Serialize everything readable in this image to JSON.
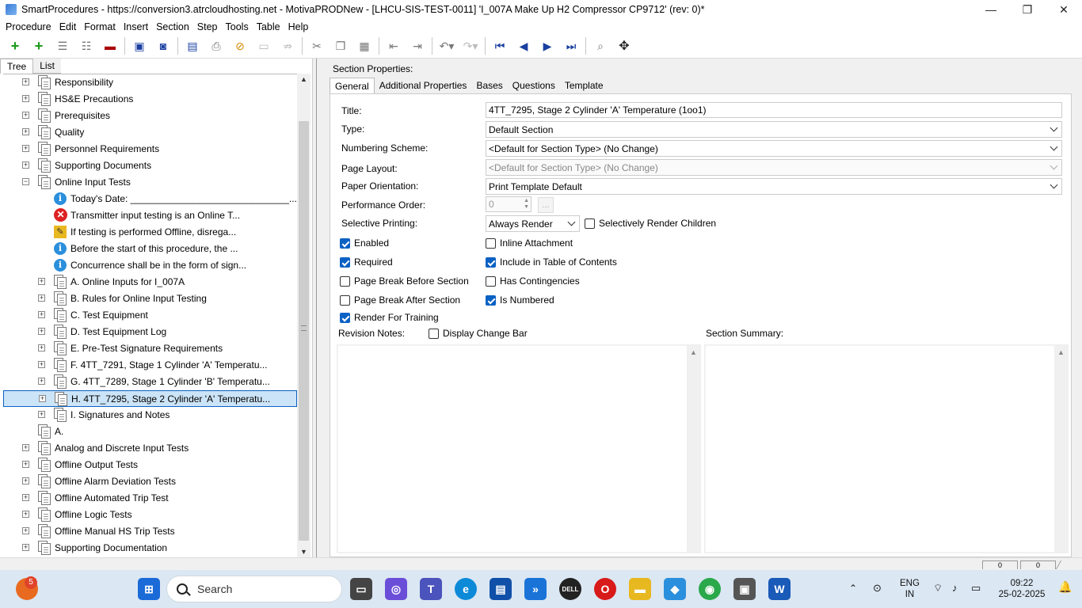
{
  "window": {
    "title": "SmartProcedures - https://conversion3.atrcloudhosting.net - MotivaPRODNew - [LHCU-SIS-TEST-0011] 'I_007A Make Up H2 Compressor CP9712' (rev: 0)*",
    "minimize": "—",
    "maximize": "❐",
    "close": "✕"
  },
  "menu": [
    "Procedure",
    "Edit",
    "Format",
    "Insert",
    "Section",
    "Step",
    "Tools",
    "Table",
    "Help"
  ],
  "left": {
    "tabs": [
      "Tree",
      "List"
    ],
    "tree": [
      {
        "label": "Responsibility",
        "level": 1,
        "icon": "doc",
        "exp": "+"
      },
      {
        "label": "HS&E Precautions",
        "level": 1,
        "icon": "doc",
        "exp": "+"
      },
      {
        "label": "Prerequisites",
        "level": 1,
        "icon": "doc",
        "exp": "+"
      },
      {
        "label": "Quality",
        "level": 1,
        "icon": "doc",
        "exp": "+"
      },
      {
        "label": "Personnel Requirements",
        "level": 1,
        "icon": "doc",
        "exp": "+"
      },
      {
        "label": "Supporting Documents",
        "level": 1,
        "icon": "doc",
        "exp": "+"
      },
      {
        "label": "Online Input Tests",
        "level": 1,
        "icon": "doc",
        "exp": "−"
      },
      {
        "label": "Today's Date: ______________________________...",
        "level": 2,
        "icon": "info",
        "exp": ""
      },
      {
        "label": "Transmitter input testing is an Online T...",
        "level": 2,
        "icon": "error",
        "exp": ""
      },
      {
        "label": "If testing is performed Offline, disrega...",
        "level": 2,
        "icon": "note",
        "exp": ""
      },
      {
        "label": "Before the start of this procedure, the ...",
        "level": 2,
        "icon": "info",
        "exp": ""
      },
      {
        "label": "Concurrence shall be in the form of sign...",
        "level": 2,
        "icon": "info",
        "exp": ""
      },
      {
        "label": "A. Online Inputs for I_007A",
        "level": 2,
        "icon": "doc",
        "exp": "+"
      },
      {
        "label": "B. Rules for Online Input Testing",
        "level": 2,
        "icon": "doc",
        "exp": "+"
      },
      {
        "label": "C. Test Equipment",
        "level": 2,
        "icon": "doc",
        "exp": "+"
      },
      {
        "label": "D. Test Equipment Log",
        "level": 2,
        "icon": "doc",
        "exp": "+"
      },
      {
        "label": "E. Pre-Test Signature Requirements",
        "level": 2,
        "icon": "doc",
        "exp": "+"
      },
      {
        "label": "F. 4TT_7291, Stage 1 Cylinder 'A' Temperatu...",
        "level": 2,
        "icon": "doc",
        "exp": "+"
      },
      {
        "label": "G. 4TT_7289, Stage 1 Cylinder 'B' Temperatu...",
        "level": 2,
        "icon": "doc",
        "exp": "+"
      },
      {
        "label": "H. 4TT_7295, Stage 2 Cylinder 'A' Temperatu...",
        "level": 2,
        "icon": "doc",
        "exp": "+",
        "selected": true
      },
      {
        "label": "I. Signatures and Notes",
        "level": 2,
        "icon": "doc",
        "exp": "+"
      },
      {
        "label": "A.",
        "level": 1,
        "icon": "doc",
        "exp": ""
      },
      {
        "label": "Analog and Discrete Input Tests",
        "level": 1,
        "icon": "doc",
        "exp": "+"
      },
      {
        "label": "Offline Output Tests",
        "level": 1,
        "icon": "doc",
        "exp": "+"
      },
      {
        "label": "Offline Alarm Deviation Tests",
        "level": 1,
        "icon": "doc",
        "exp": "+"
      },
      {
        "label": "Offline Automated Trip Test",
        "level": 1,
        "icon": "doc",
        "exp": "+"
      },
      {
        "label": "Offline Logic Tests",
        "level": 1,
        "icon": "doc",
        "exp": "+"
      },
      {
        "label": "Offline Manual HS Trip Tests",
        "level": 1,
        "icon": "doc",
        "exp": "+"
      },
      {
        "label": "Supporting Documentation",
        "level": 1,
        "icon": "doc",
        "exp": "+"
      }
    ]
  },
  "right": {
    "header": "Section Properties:",
    "tabs": [
      "General",
      "Additional Properties",
      "Bases",
      "Questions",
      "Template"
    ],
    "labels": {
      "title": "Title:",
      "type": "Type:",
      "numbering": "Numbering Scheme:",
      "page_layout": "Page Layout:",
      "orientation": "Paper Orientation:",
      "perf_order": "Performance Order:",
      "selective": "Selective Printing:",
      "revision_notes": "Revision Notes:",
      "section_summary": "Section Summary:"
    },
    "values": {
      "title": "4TT_7295, Stage 2 Cylinder 'A' Temperature (1oo1)",
      "type": "Default Section",
      "numbering": "<Default for Section Type> (No Change)",
      "page_layout": "<Default for Section Type> (No Change)",
      "orientation": "Print Template Default",
      "perf_order": "0",
      "perf_btn": "...",
      "selective": "Always Render"
    },
    "checkboxes": {
      "selectively_render_children": {
        "label": "Selectively Render Children",
        "checked": false
      },
      "enabled": {
        "label": "Enabled",
        "checked": true
      },
      "inline_attachment": {
        "label": "Inline Attachment",
        "checked": false
      },
      "required": {
        "label": "Required",
        "checked": true
      },
      "include_toc": {
        "label": "Include in Table of Contents",
        "checked": true
      },
      "page_break_before": {
        "label": "Page Break Before Section",
        "checked": false
      },
      "has_contingencies": {
        "label": "Has Contingencies",
        "checked": false
      },
      "page_break_after": {
        "label": "Page Break After Section",
        "checked": false
      },
      "is_numbered": {
        "label": "Is Numbered",
        "checked": true
      },
      "render_training": {
        "label": "Render For Training",
        "checked": true
      },
      "display_change_bar": {
        "label": "Display Change Bar",
        "checked": false
      }
    }
  },
  "statusbar": {
    "box1": "0",
    "box2": "0"
  },
  "taskbar": {
    "search": "Search",
    "notification_count": "5",
    "lang_line1": "ENG",
    "lang_line2": "IN",
    "time": "09:22",
    "date": "25-02-2025"
  },
  "colors": {
    "accent": "#0a61c4",
    "selection": "#cce4f7",
    "taskbar": "#dbe7f3"
  }
}
